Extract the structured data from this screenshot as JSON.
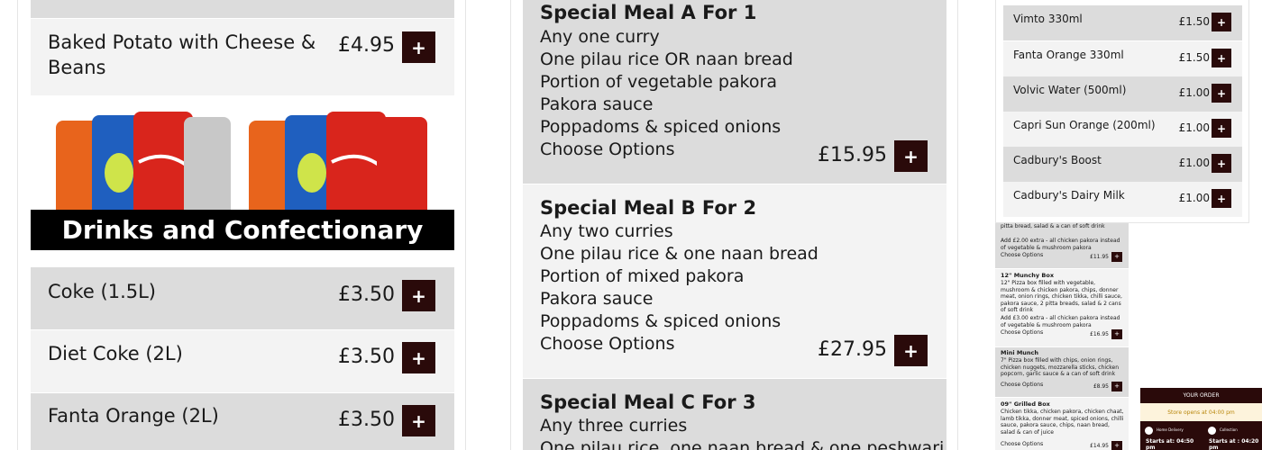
{
  "col1": {
    "top_item": {
      "name_line1": "Baked Potato with Cheese &",
      "name_line2": "Beans",
      "price": "£4.95"
    },
    "banner": "Drinks and Confectionary",
    "items": [
      {
        "name": "Coke (1.5L)",
        "price": "£3.50"
      },
      {
        "name": "Diet Coke (2L)",
        "price": "£3.50"
      },
      {
        "name": "Fanta Orange (2L)",
        "price": "£3.50"
      }
    ],
    "add_label": "+"
  },
  "col2": {
    "meals": [
      {
        "title": "Special Meal A For 1",
        "lines": [
          "Any one curry",
          "One pilau rice OR naan bread",
          "Portion of vegetable pakora",
          "Pakora sauce",
          "Poppadoms & spiced onions",
          "Choose Options"
        ],
        "price": "£15.95"
      },
      {
        "title": "Special Meal B For 2",
        "lines": [
          "Any two curries",
          "One pilau rice & one naan bread",
          "Portion of mixed pakora",
          "Pakora sauce",
          "Poppadoms & spiced onions",
          "Choose Options"
        ],
        "price": "£27.95"
      },
      {
        "title": "Special Meal C For 3",
        "lines": [
          "Any three curries",
          "One pilau rice, one naan bread & one peshwari"
        ]
      }
    ]
  },
  "drinks": [
    {
      "name": "Vimto 330ml",
      "price": "£1.50"
    },
    {
      "name": "Fanta Orange 330ml",
      "price": "£1.50"
    },
    {
      "name": "Volvic Water (500ml)",
      "price": "£1.00"
    },
    {
      "name": "Capri Sun Orange (200ml)",
      "price": "£1.00"
    },
    {
      "name": "Cadbury's Boost",
      "price": "£1.00"
    },
    {
      "name": "Cadbury's Dairy Milk",
      "price": "£1.00"
    }
  ],
  "mini": {
    "top_desc": "pitta bread, salad & a can of soft drink",
    "top_extra": "Add £2.00 extra - all chicken pakora instead of vegetable & mushroom pakora",
    "top_options": "Choose Options",
    "top_price": "£11.95",
    "items": [
      {
        "title": "12\" Munchy Box",
        "desc": "12\" Pizza box filled with vegetable, mushroom & chicken pakora, chips, donner meat, onion rings, chicken tikka, chilli sauce, pakora sauce, 2 pitta breads, salad & 2 cans of soft drink",
        "extra": "Add £3.00 extra - all chicken pakora instead of vegetable & mushroom pakora",
        "options": "Choose Options",
        "price": "£16.95"
      },
      {
        "title": "Mini Munch",
        "desc": "7\" Pizza box filled with chips, onion rings, chicken nuggets, mozzarella sticks, chicken popcorn, garlic sauce & a can of soft drink",
        "options": "Choose Options",
        "price": "£8.95"
      },
      {
        "title": "09\" Grilled Box",
        "desc": "Chicken tikka, chicken pakora, chicken chaat, lamb tikka, donner meat, spiced onions, chilli sauce, pakora sauce, chips, naan bread, salad & can of juice",
        "options": "Choose Options",
        "price": "£14.95"
      }
    ]
  },
  "order": {
    "title": "YOUR ORDER",
    "status": "Store opens at 04:00 pm",
    "delivery_label": "Home Delivery",
    "delivery_start": "Starts at: 04:50 pm",
    "collection_label": "Collection",
    "collection_start": "Starts at : 04:20 pm"
  },
  "colors": {
    "button": "#2a0a0a",
    "row_dark": "#dcdcdc",
    "row_light": "#f3f3f3",
    "banner": "#000000"
  }
}
